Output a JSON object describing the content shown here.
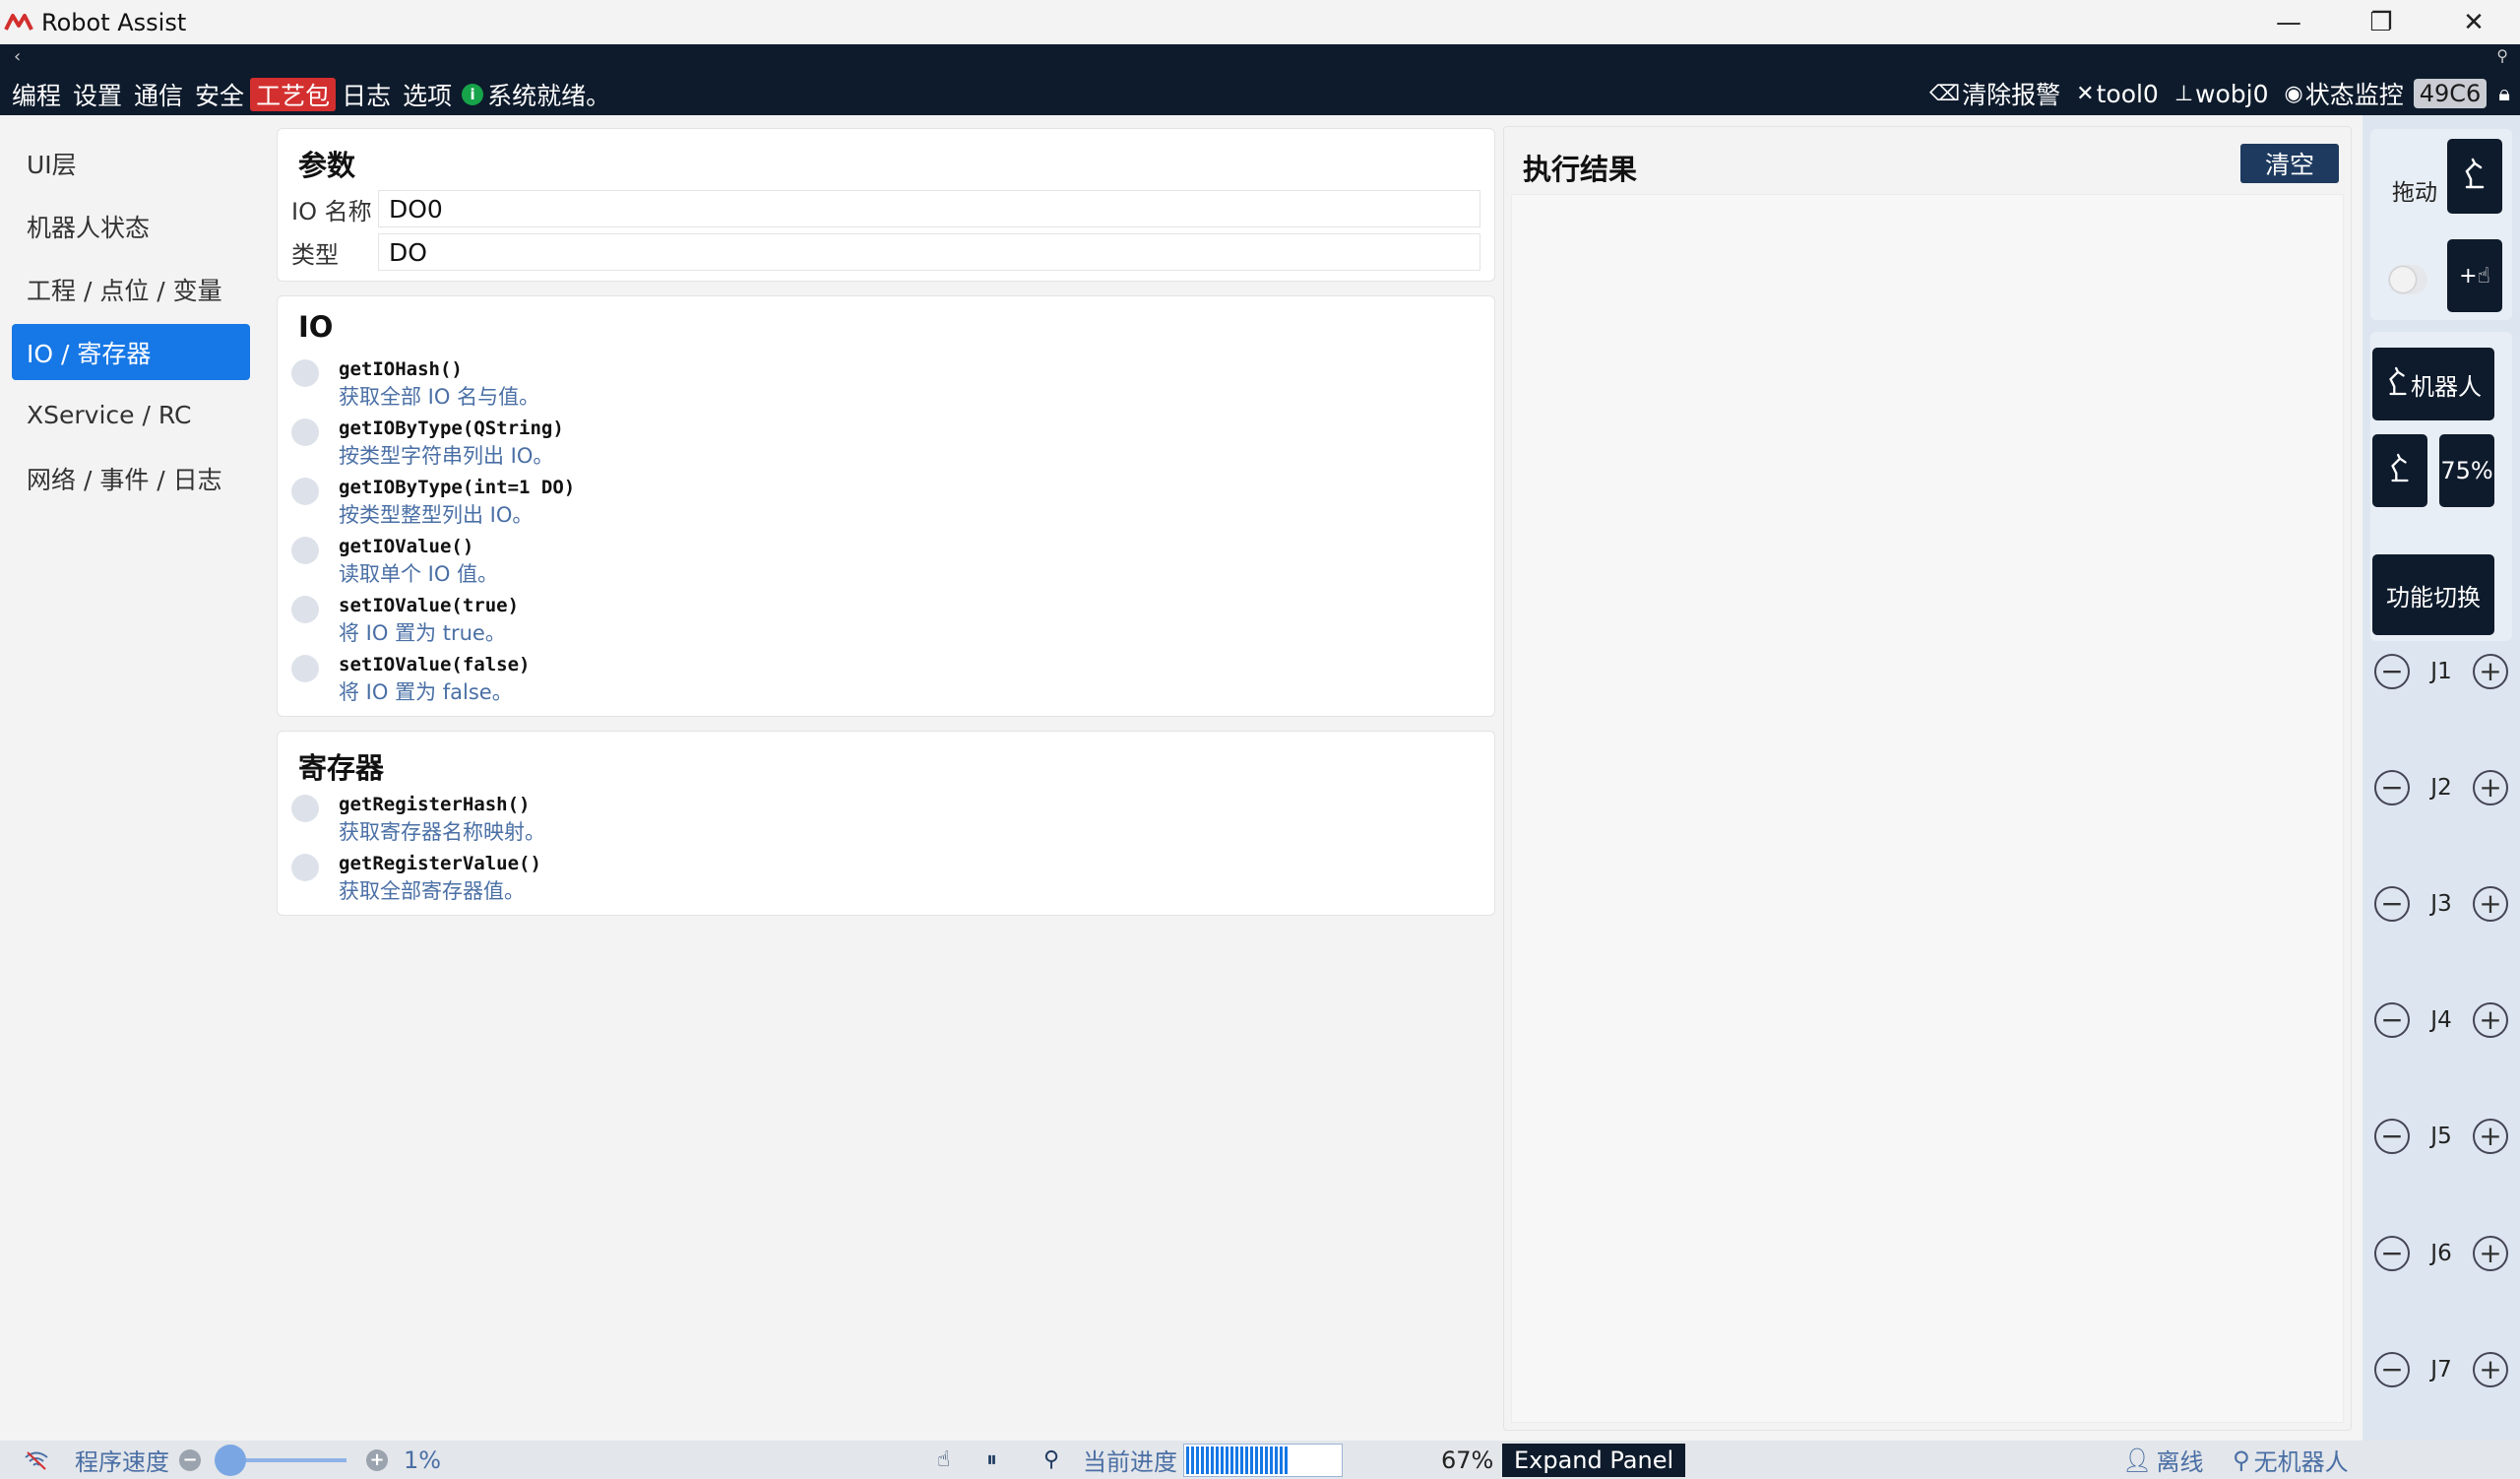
{
  "window": {
    "title": "Robot Assist",
    "controls": [
      "—",
      "❐",
      "✕"
    ]
  },
  "menubar": {
    "items": [
      "编程",
      "设置",
      "通信",
      "安全",
      "工艺包",
      "日志",
      "选项"
    ],
    "active_item": "工艺包",
    "status_text": "系统就绪。",
    "right": {
      "clear_alarm": "清除报警",
      "tool": "tool0",
      "wobj": "wobj0",
      "monitor": "状态监控",
      "code": "49C6"
    }
  },
  "sidebar": {
    "items": [
      {
        "label": "UI层"
      },
      {
        "label": "机器人状态"
      },
      {
        "label": "工程 / 点位 / 变量"
      },
      {
        "label": "IO / 寄存器"
      },
      {
        "label": "XService / RC"
      },
      {
        "label": "网络 / 事件 / 日志"
      }
    ],
    "active_index": 3
  },
  "params": {
    "title": "参数",
    "io_name_label": "IO 名称",
    "io_name_value": "DO0",
    "type_label": "类型",
    "type_value": "DO"
  },
  "io_section": {
    "title": "IO",
    "functions": [
      {
        "name": "getIOHash()",
        "desc": "获取全部 IO 名与值。"
      },
      {
        "name": "getIOByType(QString)",
        "desc": "按类型字符串列出 IO。"
      },
      {
        "name": "getIOByType(int=1 DO)",
        "desc": "按类型整型列出 IO。"
      },
      {
        "name": "getIOValue()",
        "desc": "读取单个 IO 值。"
      },
      {
        "name": "setIOValue(true)",
        "desc": "将 IO 置为 true。"
      },
      {
        "name": "setIOValue(false)",
        "desc": "将 IO 置为 false。"
      }
    ]
  },
  "register_section": {
    "title": "寄存器",
    "functions": [
      {
        "name": "getRegisterHash()",
        "desc": "获取寄存器名称映射。"
      },
      {
        "name": "getRegisterValue()",
        "desc": "获取全部寄存器值。"
      }
    ]
  },
  "result": {
    "title": "执行结果",
    "clear_label": "清空"
  },
  "jog": {
    "drag_label": "拖动",
    "robot_label": "机器人",
    "speed": "75%",
    "function_switch": "功能切换",
    "joints": [
      "J1",
      "J2",
      "J3",
      "J4",
      "J5",
      "J6",
      "J7"
    ]
  },
  "statusbar": {
    "program_speed_label": "程序速度",
    "program_speed_value": "1%",
    "progress_label": "当前进度",
    "progress_value": "67%",
    "progress_fraction": 0.67,
    "expand_label": "Expand Panel",
    "offline_label": "离线",
    "no_robot_label": "无机器人"
  }
}
